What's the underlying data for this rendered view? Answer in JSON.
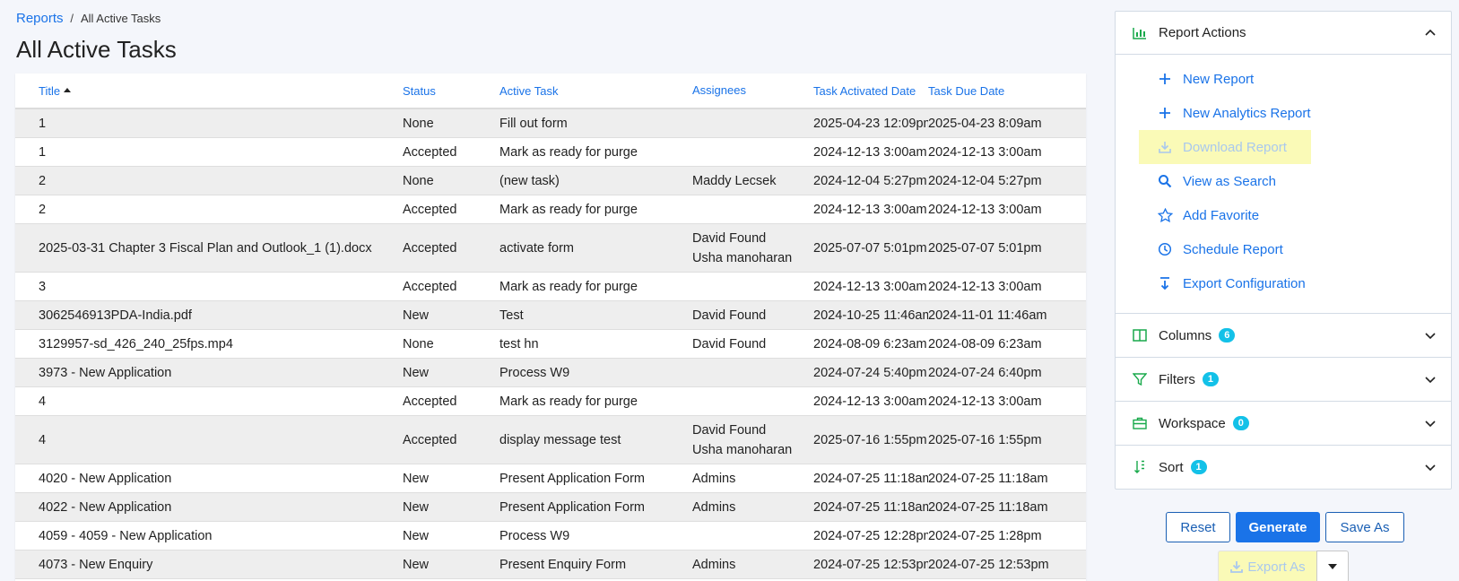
{
  "breadcrumb": {
    "link": "Reports",
    "separator": "/",
    "current": "All Active Tasks"
  },
  "page_title": "All Active Tasks",
  "table": {
    "columns": [
      "Title",
      "Status",
      "Active Task",
      "Assignees",
      "Task Activated Date",
      "Task Due Date"
    ],
    "rows": [
      {
        "title": "1",
        "status": "None",
        "task": "Fill out form",
        "assignees": [
          ""
        ],
        "activated": "2025-04-23 12:09pm",
        "due": "2025-04-23 8:09am"
      },
      {
        "title": "1",
        "status": "Accepted",
        "task": "Mark as ready for purge",
        "assignees": [
          ""
        ],
        "activated": "2024-12-13 3:00am",
        "due": "2024-12-13 3:00am"
      },
      {
        "title": "2",
        "status": "None",
        "task": "(new task)",
        "assignees": [
          "Maddy Lecsek"
        ],
        "activated": "2024-12-04 5:27pm",
        "due": "2024-12-04 5:27pm"
      },
      {
        "title": "2",
        "status": "Accepted",
        "task": "Mark as ready for purge",
        "assignees": [
          ""
        ],
        "activated": "2024-12-13 3:00am",
        "due": "2024-12-13 3:00am"
      },
      {
        "title": "2025-03-31 Chapter 3 Fiscal Plan and Outlook_1 (1).docx",
        "status": "Accepted",
        "task": "activate form",
        "assignees": [
          "David Found",
          "Usha manoharan"
        ],
        "activated": "2025-07-07 5:01pm",
        "due": "2025-07-07 5:01pm"
      },
      {
        "title": "3",
        "status": "Accepted",
        "task": "Mark as ready for purge",
        "assignees": [
          ""
        ],
        "activated": "2024-12-13 3:00am",
        "due": "2024-12-13 3:00am"
      },
      {
        "title": "3062546913PDA-India.pdf",
        "status": "New",
        "task": "Test",
        "assignees": [
          "David Found"
        ],
        "activated": "2024-10-25 11:46am",
        "due": "2024-11-01 11:46am"
      },
      {
        "title": "3129957-sd_426_240_25fps.mp4",
        "status": "None",
        "task": "test hn",
        "assignees": [
          "David Found"
        ],
        "activated": "2024-08-09 6:23am",
        "due": "2024-08-09 6:23am"
      },
      {
        "title": "3973 - New Application",
        "status": "New",
        "task": "Process W9",
        "assignees": [
          ""
        ],
        "activated": "2024-07-24 5:40pm",
        "due": "2024-07-24 6:40pm"
      },
      {
        "title": "4",
        "status": "Accepted",
        "task": "Mark as ready for purge",
        "assignees": [
          ""
        ],
        "activated": "2024-12-13 3:00am",
        "due": "2024-12-13 3:00am"
      },
      {
        "title": "4",
        "status": "Accepted",
        "task": "display message test",
        "assignees": [
          "David Found",
          "Usha manoharan"
        ],
        "activated": "2025-07-16 1:55pm",
        "due": "2025-07-16 1:55pm"
      },
      {
        "title": "4020 - New Application",
        "status": "New",
        "task": "Present Application Form",
        "assignees": [
          "Admins"
        ],
        "activated": "2024-07-25 11:18am",
        "due": "2024-07-25 11:18am"
      },
      {
        "title": "4022 - New Application",
        "status": "New",
        "task": "Present Application Form",
        "assignees": [
          "Admins"
        ],
        "activated": "2024-07-25 11:18am",
        "due": "2024-07-25 11:18am"
      },
      {
        "title": "4059 - 4059 - New Application",
        "status": "New",
        "task": "Process W9",
        "assignees": [
          ""
        ],
        "activated": "2024-07-25 12:28pm",
        "due": "2024-07-25 1:28pm"
      },
      {
        "title": "4073 - New Enquiry",
        "status": "New",
        "task": "Present Enquiry Form",
        "assignees": [
          "Admins"
        ],
        "activated": "2024-07-25 12:53pm",
        "due": "2024-07-25 12:53pm"
      }
    ]
  },
  "panel": {
    "report_actions": {
      "title": "Report Actions",
      "items": [
        {
          "label": "New Report",
          "icon": "plus-icon",
          "disabled": false
        },
        {
          "label": "New Analytics Report",
          "icon": "plus-icon",
          "disabled": false
        },
        {
          "label": "Download Report",
          "icon": "download-icon",
          "disabled": true
        },
        {
          "label": "View as Search",
          "icon": "search-icon",
          "disabled": false
        },
        {
          "label": "Add Favorite",
          "icon": "star-icon",
          "disabled": false
        },
        {
          "label": "Schedule Report",
          "icon": "clock-icon",
          "disabled": false
        },
        {
          "label": "Export Configuration",
          "icon": "export-config-icon",
          "disabled": false
        }
      ]
    },
    "columns": {
      "title": "Columns",
      "count": "6"
    },
    "filters": {
      "title": "Filters",
      "count": "1"
    },
    "workspace": {
      "title": "Workspace",
      "count": "0"
    },
    "sort": {
      "title": "Sort",
      "count": "1"
    }
  },
  "buttons": {
    "reset": "Reset",
    "generate": "Generate",
    "save_as": "Save As",
    "export_as": "Export As"
  },
  "colors": {
    "accent": "#1a73e8",
    "icon_green": "#18a94b",
    "badge": "#13c1e8",
    "highlight": "#fafab7"
  }
}
